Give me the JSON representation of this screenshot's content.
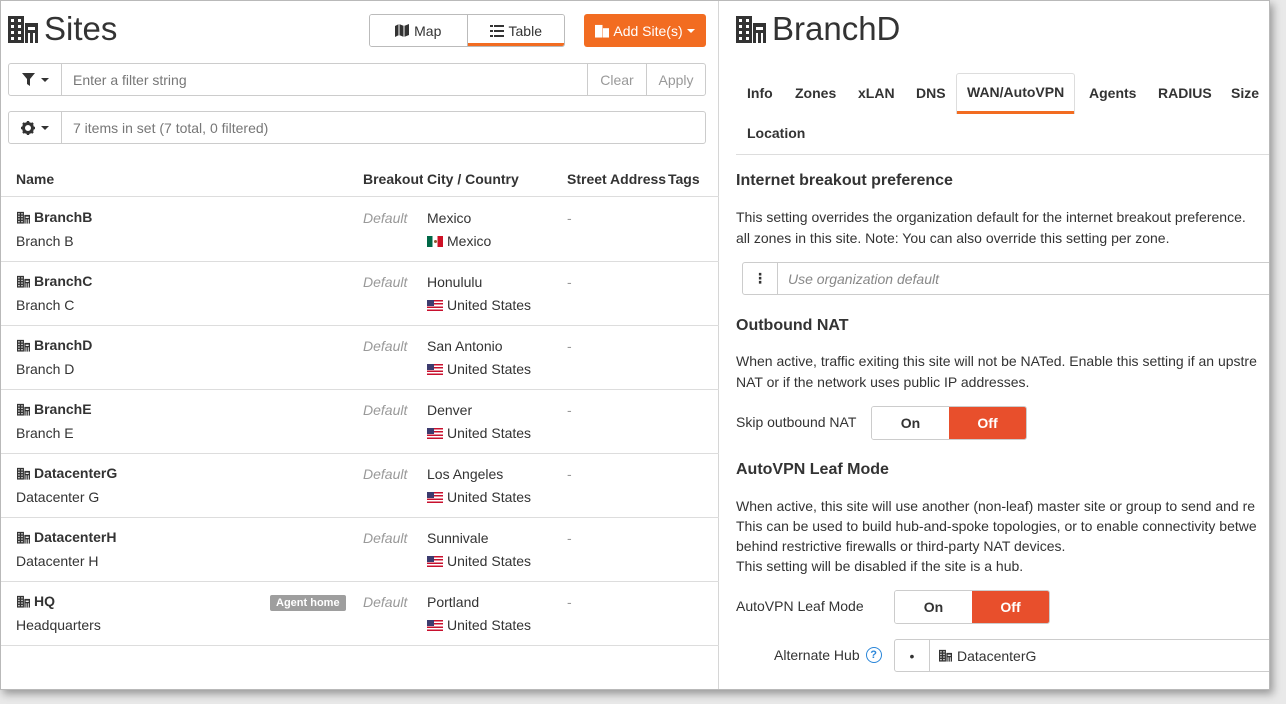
{
  "sites": {
    "title": "Sites",
    "view_map_label": "Map",
    "view_table_label": "Table",
    "add_button_label": "Add Site(s)",
    "filter_placeholder": "Enter a filter string",
    "clear_label": "Clear",
    "apply_label": "Apply",
    "set_info": "7 items in set (7 total, 0 filtered)",
    "columns": [
      "Name",
      "Breakout",
      "City / Country",
      "Street Address",
      "Tags"
    ],
    "rows": [
      {
        "name": "BranchB",
        "desc": "Branch B",
        "breakout": "Default",
        "city": "Mexico",
        "country": "Mexico",
        "flag": "mx",
        "address": "-"
      },
      {
        "name": "BranchC",
        "desc": "Branch C",
        "breakout": "Default",
        "city": "Honululu",
        "country": "United States",
        "flag": "us",
        "address": "-"
      },
      {
        "name": "BranchD",
        "desc": "Branch D",
        "breakout": "Default",
        "city": "San Antonio",
        "country": "United States",
        "flag": "us",
        "address": "-"
      },
      {
        "name": "BranchE",
        "desc": "Branch E",
        "breakout": "Default",
        "city": "Denver",
        "country": "United States",
        "flag": "us",
        "address": "-"
      },
      {
        "name": "DatacenterG",
        "desc": "Datacenter G",
        "breakout": "Default",
        "city": "Los Angeles",
        "country": "United States",
        "flag": "us",
        "address": "-"
      },
      {
        "name": "DatacenterH",
        "desc": "Datacenter H",
        "breakout": "Default",
        "city": "Sunnivale",
        "country": "United States",
        "flag": "us",
        "address": "-"
      },
      {
        "name": "HQ",
        "desc": "Headquarters",
        "breakout": "Default",
        "city": "Portland",
        "country": "United States",
        "flag": "us",
        "address": "-",
        "badge": "Agent home"
      }
    ]
  },
  "detail": {
    "title": "BranchD",
    "tabs": [
      "Info",
      "Zones",
      "xLAN",
      "DNS",
      "WAN/AutoVPN",
      "Agents",
      "RADIUS",
      "Size",
      "Location"
    ],
    "active_tab": "WAN/AutoVPN",
    "breakout": {
      "heading": "Internet breakout preference",
      "text1": "This setting overrides the organization default for the internet breakout preference.",
      "text2": "all zones in this site. Note: You can also override this setting per zone.",
      "select_value": "Use organization default"
    },
    "nat": {
      "heading": "Outbound NAT",
      "text1": "When active, traffic exiting this site will not be NATed. Enable this setting if an upstre",
      "text2": "NAT or if the network uses public IP addresses.",
      "label": "Skip outbound NAT",
      "on_label": "On",
      "off_label": "Off"
    },
    "leaf": {
      "heading": "AutoVPN Leaf Mode",
      "text1": "When active, this site will use another (non-leaf) master site or group to send and re",
      "text2": "This can be used to build hub-and-spoke topologies, or to enable connectivity betwe",
      "text3": "behind restrictive firewalls or third-party NAT devices.",
      "text4": "This setting will be disabled if the site is a hub.",
      "label": "AutoVPN Leaf Mode",
      "on_label": "On",
      "off_label": "Off"
    },
    "hub": {
      "label": "Alternate Hub",
      "value": "DatacenterG"
    }
  },
  "colors": {
    "accent": "#f26c21",
    "off_red": "#e84f2c",
    "help_blue": "#2a86d9"
  }
}
